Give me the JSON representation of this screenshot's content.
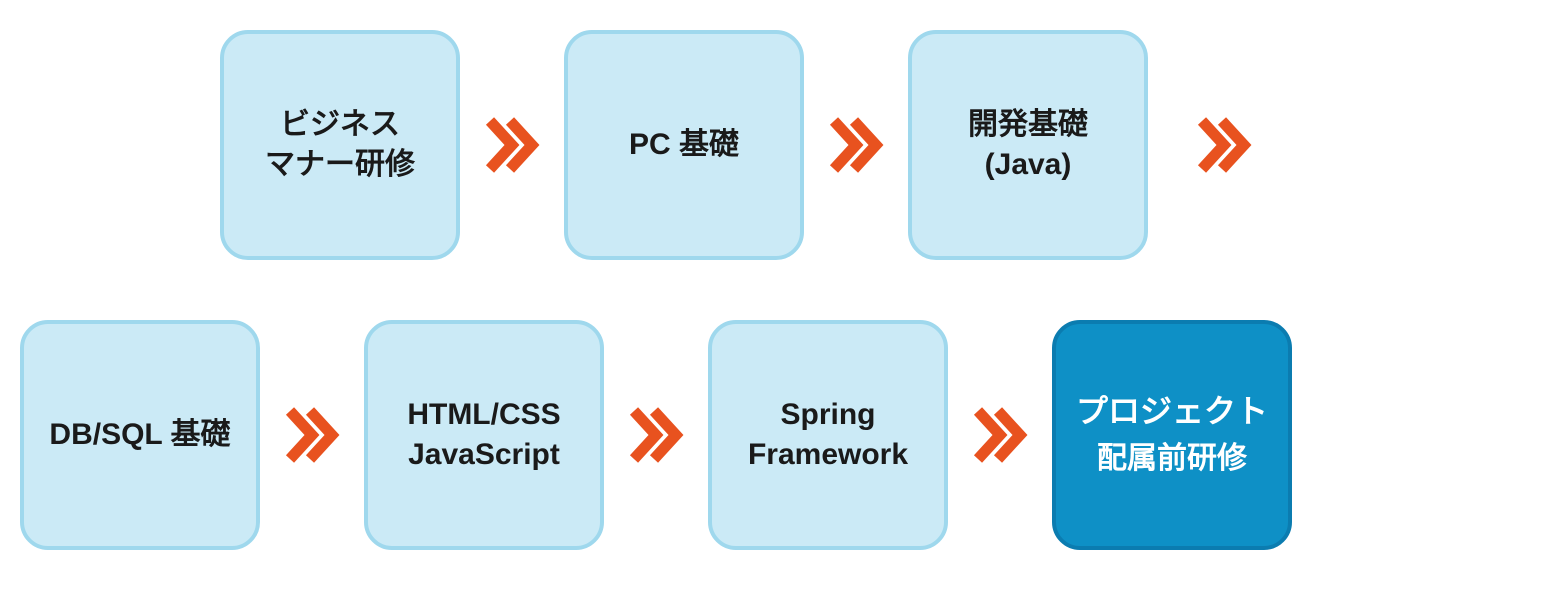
{
  "colors": {
    "card_light_bg": "#cbeaf6",
    "card_light_border": "#9fd8ed",
    "card_light_text": "#1a1a1a",
    "card_dark_bg": "#0e90c6",
    "card_dark_border": "#0b7cb0",
    "card_dark_text": "#ffffff",
    "arrow": "#e8521f"
  },
  "row1": {
    "c1": {
      "l1": "ビジネス",
      "l2": "マナー研修"
    },
    "c2": {
      "l1": "PC 基礎"
    },
    "c3": {
      "l1": "開発基礎",
      "l2": "(Java)"
    }
  },
  "row2": {
    "c1": {
      "l1": "DB/SQL 基礎"
    },
    "c2": {
      "l1": "HTML/CSS",
      "l2": "JavaScript"
    },
    "c3": {
      "l1": "Spring",
      "l2": "Framework"
    },
    "c4": {
      "l1": "プロジェクト",
      "l2": "配属前研修"
    }
  }
}
